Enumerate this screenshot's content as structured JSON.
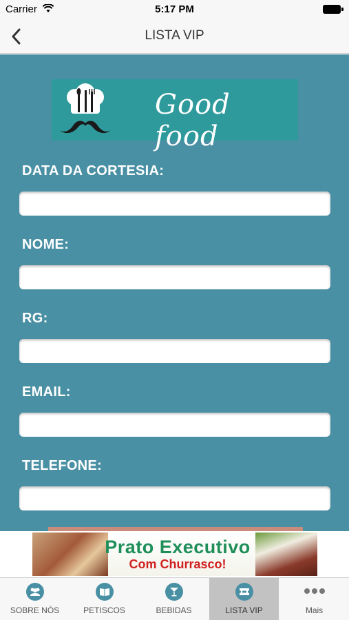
{
  "status_bar": {
    "carrier": "Carrier",
    "time": "5:17 PM"
  },
  "nav": {
    "title": "LISTA VIP",
    "back_icon": "chevron-left-icon"
  },
  "logo": {
    "text": "Good food",
    "background": "#2e9a9c"
  },
  "form": {
    "background": "#4a90a4",
    "fields": [
      {
        "label": "DATA DA CORTESIA:",
        "value": "",
        "placeholder": ""
      },
      {
        "label": "NOME:",
        "value": "",
        "placeholder": ""
      },
      {
        "label": "RG:",
        "value": "",
        "placeholder": ""
      },
      {
        "label": "EMAIL:",
        "value": "",
        "placeholder": ""
      },
      {
        "label": "TELEFONE:",
        "value": "",
        "placeholder": ""
      }
    ]
  },
  "ad": {
    "title": "Prato Executivo",
    "subtitle": "Com Churrasco!",
    "title_color": "#1f8f5a",
    "subtitle_color": "#d02020"
  },
  "tab_bar": {
    "active_index": 3,
    "tabs": [
      {
        "label": "SOBRE NÓS",
        "icon": "group-icon"
      },
      {
        "label": "PETISCOS",
        "icon": "menu-book-icon"
      },
      {
        "label": "BEBIDAS",
        "icon": "cocktail-icon"
      },
      {
        "label": "LISTA VIP",
        "icon": "ticket-icon"
      },
      {
        "label": "Mais",
        "icon": "more-dots-icon"
      }
    ]
  }
}
